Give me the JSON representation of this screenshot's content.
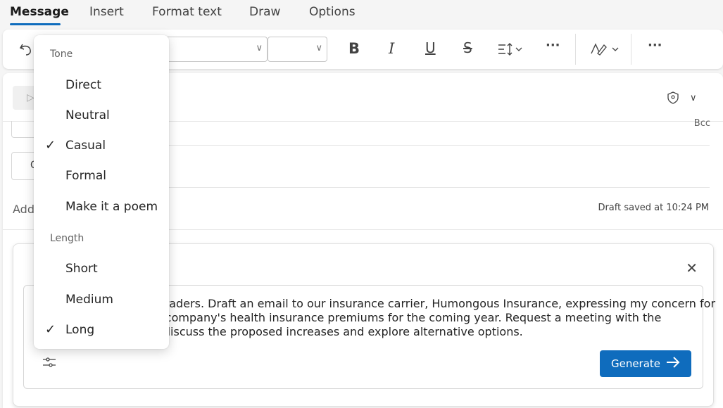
{
  "tabs": [
    {
      "label": "Message",
      "active": true
    },
    {
      "label": "Insert"
    },
    {
      "label": "Format text"
    },
    {
      "label": "Draw"
    },
    {
      "label": "Options"
    }
  ],
  "toolbar": {
    "icons": [
      "undo-icon",
      "font-combo",
      "size-combo",
      "bold-icon",
      "italic-icon",
      "underline-icon",
      "strikethrough-icon",
      "line-spacing-icon",
      "more-icon",
      "editor-icon",
      "more-icon"
    ],
    "bold": "B",
    "italic": "I",
    "underline": "U",
    "strike": "S",
    "more": "···"
  },
  "compose": {
    "bcc": "Bcc",
    "cc_fragment": "C",
    "add_fragment": "Add",
    "draft_saved": "Draft saved at 10:24 PM"
  },
  "copilot": {
    "prompt_lines": [
      "d Traders. Draft an email to our insurance carrier, Humongous Insurance, expressing my concern for",
      "ur company's health insurance premiums for the coming year. Request a meeting with the",
      "o discuss the proposed increases and explore alternative options."
    ],
    "generate_label": "Generate"
  },
  "menu": {
    "tone_header": "Tone",
    "tone_items": [
      {
        "label": "Direct",
        "checked": false
      },
      {
        "label": "Neutral",
        "checked": false
      },
      {
        "label": "Casual",
        "checked": true
      },
      {
        "label": "Formal",
        "checked": false
      },
      {
        "label": "Make it a poem",
        "checked": false
      }
    ],
    "length_header": "Length",
    "length_items": [
      {
        "label": "Short",
        "checked": false
      },
      {
        "label": "Medium",
        "checked": false
      },
      {
        "label": "Long",
        "checked": true
      }
    ]
  },
  "colors": {
    "accent": "#0f6cbd",
    "background": "#f5f5f5"
  }
}
